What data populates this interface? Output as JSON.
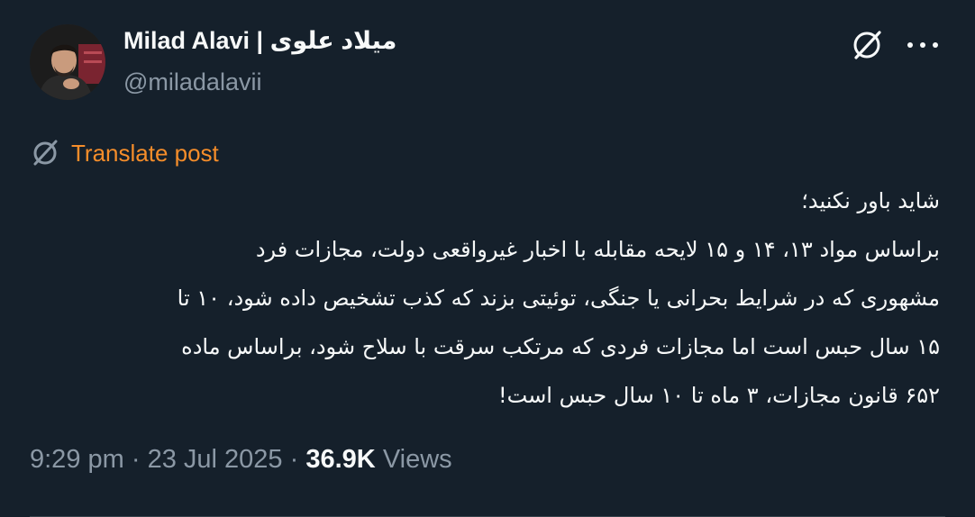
{
  "author": {
    "name": "Milad Alavi | میلاد علوی",
    "handle": "@miladalavii"
  },
  "actions": {
    "grok_icon": "grok-slash-icon",
    "more_icon": "more-dots-icon"
  },
  "translate": {
    "label": "Translate post",
    "icon": "translate-icon"
  },
  "tweet": {
    "lines": [
      "شاید باور نکنید؛",
      "براساس مواد ۱۳، ۱۴ و ۱۵ لایحه مقابله با اخبار غیرواقعی دولت، مجازات فرد",
      "مشهوری که در شرایط بحرانی یا جنگی، توئیتی بزند که کذب تشخیص داده شود، ۱۰ تا",
      "۱۵ سال حبس است اما مجازات فردی که مرتکب سرقت با سلاح شود، براساس ماده",
      "۶۵۲ قانون مجازات، ۳ ماه تا ۱۰ سال حبس است!"
    ]
  },
  "meta": {
    "time": "9:29 pm",
    "date": "23 Jul 2025",
    "separator": "·",
    "views_count": "36.9K",
    "views_label": "Views"
  },
  "colors": {
    "background": "#15202b",
    "text": "#f7f9f9",
    "muted": "#8b98a5",
    "translate": "#f58d2a"
  }
}
